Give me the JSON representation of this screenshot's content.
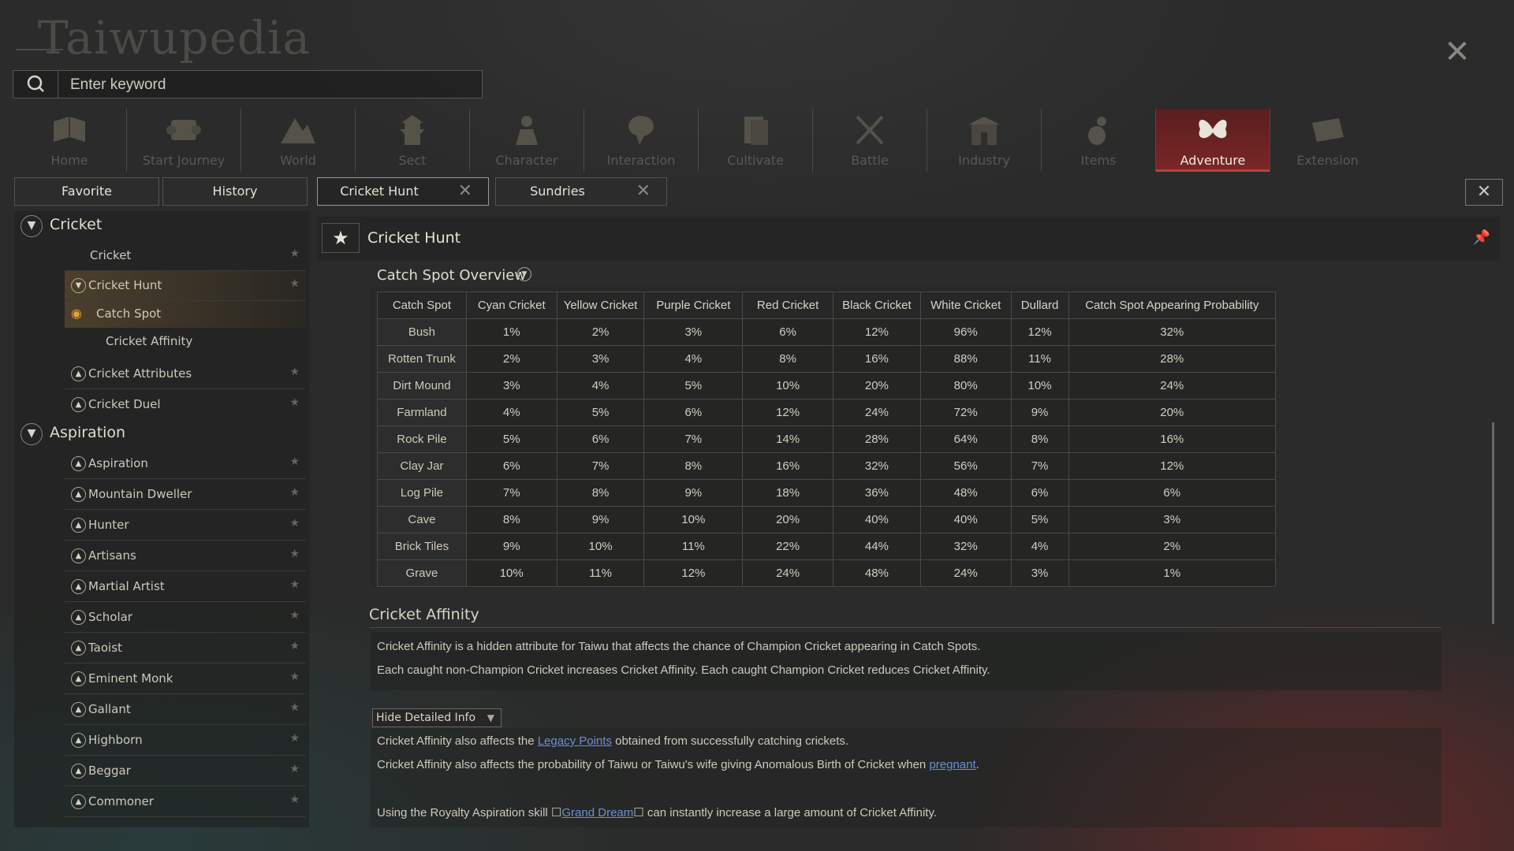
{
  "app": {
    "title": "Taiwupedia"
  },
  "search": {
    "placeholder": "Enter keyword",
    "value": ""
  },
  "nav": [
    {
      "label": "Home",
      "icon": "book-icon"
    },
    {
      "label": "Start Journey",
      "icon": "scroll-icon"
    },
    {
      "label": "World",
      "icon": "mountain-icon"
    },
    {
      "label": "Sect",
      "icon": "pagoda-icon"
    },
    {
      "label": "Character",
      "icon": "person-icon"
    },
    {
      "label": "Interaction",
      "icon": "speech-bubble-icon"
    },
    {
      "label": "Cultivate",
      "icon": "manual-icon"
    },
    {
      "label": "Battle",
      "icon": "crossed-swords-icon"
    },
    {
      "label": "Industry",
      "icon": "building-icon"
    },
    {
      "label": "Items",
      "icon": "gourd-icon"
    },
    {
      "label": "Adventure",
      "icon": "butterfly-icon",
      "active": true
    },
    {
      "label": "Extension",
      "icon": "map-icon"
    }
  ],
  "tabs": {
    "favorite": "Favorite",
    "history": "History",
    "open": [
      "Cricket Hunt",
      "Sundries"
    ]
  },
  "sidebar": {
    "cricket_section": "Cricket",
    "cricket_items": [
      "Cricket",
      "Cricket Hunt",
      "Catch Spot",
      "Cricket Affinity",
      "Cricket Attributes",
      "Cricket Duel"
    ],
    "aspiration_section": "Aspiration",
    "aspiration_items": [
      "Aspiration",
      "Mountain Dweller",
      "Hunter",
      "Artisans",
      "Martial Artist",
      "Scholar",
      "Taoist",
      "Eminent Monk",
      "Gallant",
      "Highborn",
      "Beggar",
      "Commoner"
    ]
  },
  "doc": {
    "title": "Cricket Hunt",
    "overview_title": "Catch Spot Overview",
    "table": {
      "headers": [
        "Catch Spot",
        "Cyan Cricket",
        "Yellow Cricket",
        "Purple Cricket",
        "Red Cricket",
        "Black Cricket",
        "White Cricket",
        "Dullard",
        "Catch Spot Appearing Probability"
      ],
      "rows": [
        [
          "Bush",
          "1%",
          "2%",
          "3%",
          "6%",
          "12%",
          "96%",
          "12%",
          "32%"
        ],
        [
          "Rotten Trunk",
          "2%",
          "3%",
          "4%",
          "8%",
          "16%",
          "88%",
          "11%",
          "28%"
        ],
        [
          "Dirt Mound",
          "3%",
          "4%",
          "5%",
          "10%",
          "20%",
          "80%",
          "10%",
          "24%"
        ],
        [
          "Farmland",
          "4%",
          "5%",
          "6%",
          "12%",
          "24%",
          "72%",
          "9%",
          "20%"
        ],
        [
          "Rock Pile",
          "5%",
          "6%",
          "7%",
          "14%",
          "28%",
          "64%",
          "8%",
          "16%"
        ],
        [
          "Clay Jar",
          "6%",
          "7%",
          "8%",
          "16%",
          "32%",
          "56%",
          "7%",
          "12%"
        ],
        [
          "Log Pile",
          "7%",
          "8%",
          "9%",
          "18%",
          "36%",
          "48%",
          "6%",
          "6%"
        ],
        [
          "Cave",
          "8%",
          "9%",
          "10%",
          "20%",
          "40%",
          "40%",
          "5%",
          "3%"
        ],
        [
          "Brick Tiles",
          "9%",
          "10%",
          "11%",
          "22%",
          "44%",
          "32%",
          "4%",
          "2%"
        ],
        [
          "Grave",
          "10%",
          "11%",
          "12%",
          "24%",
          "48%",
          "24%",
          "3%",
          "1%"
        ]
      ]
    },
    "affinity_title": "Cricket Affinity",
    "affinity_p1": "Cricket Affinity is a hidden attribute for Taiwu that affects the chance of Champion Cricket appearing in Catch Spots.",
    "affinity_p2": "Each caught non-Champion Cricket increases Cricket Affinity. Each caught Champion Cricket reduces Cricket Affinity.",
    "hide_button": "Hide Detailed Info",
    "detail1_pre": "Cricket Affinity also affects the ",
    "detail1_link": "Legacy Points",
    "detail1_post": " obtained from successfully catching crickets.",
    "detail2_pre": "Cricket Affinity also affects the probability of Taiwu or Taiwu's wife giving Anomalous Birth of Cricket when ",
    "detail2_link": "pregnant",
    "detail2_post": ".",
    "detail3_pre": "Using the Royalty Aspiration skill ",
    "detail3_link": "Grand Dream",
    "detail3_post": " can instantly increase a large amount of Cricket Affinity."
  },
  "colors": {
    "active_tab": "#7a2626",
    "link": "#6a8fd6",
    "background": "#2a2b2a"
  }
}
